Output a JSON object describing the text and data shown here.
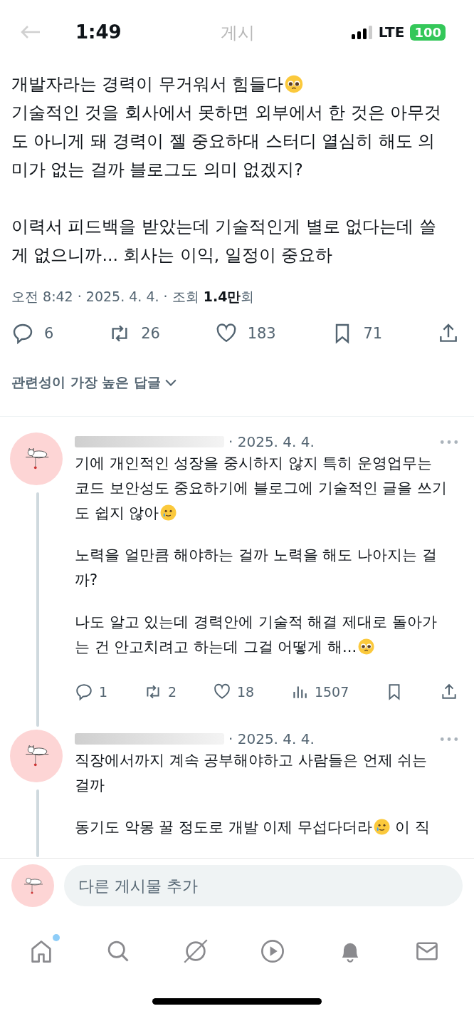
{
  "status_bar": {
    "time": "1:49",
    "network": "LTE",
    "battery": "100"
  },
  "header": {
    "title": "게시"
  },
  "post": {
    "paragraphs": [
      [
        [
          {
            "kind": "text",
            "text": "개발자라는 경력이 무거워서 힘들다"
          },
          {
            "kind": "pleading-emoji"
          }
        ],
        [
          {
            "kind": "text",
            "text": "기술적인 것을 회사에서 못하면 외부에서 한 것은 아무것"
          }
        ],
        [
          {
            "kind": "text",
            "text": "도 아니게 돼 경력이 젤 중요하대 스터디 열심히 해도 의"
          }
        ],
        [
          {
            "kind": "text",
            "text": "미가 없는 걸까 블로그도 의미 없겠지?"
          }
        ]
      ],
      [
        [
          {
            "kind": "text",
            "text": "이력서 피드백을 받았는데 기술적인게 별로 없다는데 쓸"
          }
        ],
        [
          {
            "kind": "text",
            "text": "게 없으니까... 회사는 이익, 일정이 중요하"
          }
        ]
      ]
    ],
    "meta": "오전 8:42 · 2025. 4. 4. · 조회 **1.4만**회",
    "actions": [
      {
        "kind": "reply",
        "count": "6"
      },
      {
        "kind": "repost",
        "count": "26"
      },
      {
        "kind": "like",
        "count": "183"
      },
      {
        "kind": "bookmark",
        "count": "71"
      },
      {
        "kind": "share"
      }
    ]
  },
  "sort": {
    "label": "관련성이 가장 높은 답글"
  },
  "replies": [
    {
      "date": "· 2025. 4. 4.",
      "thread": true,
      "paragraphs": [
        [
          [
            {
              "kind": "text",
              "text": "기에 개인적인 성장을 중시하지 않지 특히 운영업무는"
            }
          ],
          [
            {
              "kind": "text",
              "text": "코드 보안성도 중요하기에 블로그에 기술적인 글을 쓰기"
            }
          ],
          [
            {
              "kind": "text",
              "text": "도 쉽지 않아"
            },
            {
              "kind": "tear-emoji"
            }
          ]
        ],
        [
          [
            {
              "kind": "text",
              "text": "노력을 얼만큼 해야하는 걸까 노력을 해도 나아지는 걸"
            }
          ],
          [
            {
              "kind": "text",
              "text": "까?"
            }
          ]
        ],
        [
          [
            {
              "kind": "text",
              "text": "나도 알고 있는데 경력안에 기술적 해결 제대로 돌아가"
            }
          ],
          [
            {
              "kind": "text",
              "text": "는 건 안고치려고 하는데 그걸 어떻게 해..."
            },
            {
              "kind": "pleading-emoji"
            }
          ]
        ]
      ],
      "actions": [
        {
          "kind": "reply",
          "count": "1"
        },
        {
          "kind": "repost",
          "count": "2"
        },
        {
          "kind": "like",
          "count": "18"
        },
        {
          "kind": "views",
          "count": "1507"
        },
        {
          "kind": "bookmark"
        },
        {
          "kind": "share"
        }
      ]
    },
    {
      "date": "· 2025. 4. 4.",
      "thread": true,
      "paragraphs": [
        [
          [
            {
              "kind": "text",
              "text": "직장에서까지 계속 공부해야하고 사람들은 언제 쉬는"
            }
          ],
          [
            {
              "kind": "text",
              "text": "걸까"
            }
          ]
        ],
        [
          [
            {
              "kind": "text",
              "text": "동기도 악몽 꿀 정도로 개발 이제 무섭다더라"
            },
            {
              "kind": "tear-emoji"
            },
            {
              "kind": "text",
              "text": " 이 직"
            }
          ]
        ]
      ]
    }
  ],
  "composer": {
    "placeholder": "다른 게시물 추가"
  },
  "tab_bar": [
    {
      "kind": "home",
      "badge": true
    },
    {
      "kind": "search",
      "badge": false
    },
    {
      "kind": "grok",
      "badge": false
    },
    {
      "kind": "video",
      "badge": false
    },
    {
      "kind": "notifications",
      "badge": false
    },
    {
      "kind": "messages",
      "badge": false
    }
  ]
}
